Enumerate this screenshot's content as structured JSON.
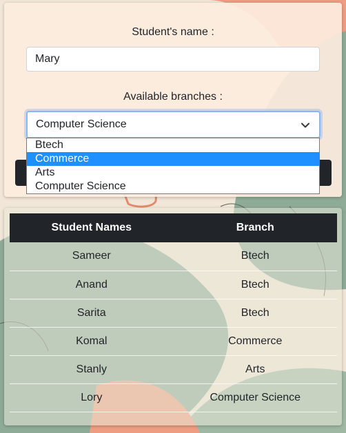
{
  "form": {
    "name_label": "Student's name :",
    "name_value": "Mary",
    "branch_label": "Available branches :",
    "selected_branch": "Computer Science",
    "options": [
      "Btech",
      "Commerce",
      "Arts",
      "Computer Science"
    ],
    "highlighted_option": "Commerce"
  },
  "table": {
    "headers": [
      "Student Names",
      "Branch"
    ],
    "rows": [
      [
        "Sameer",
        "Btech"
      ],
      [
        "Anand",
        "Btech"
      ],
      [
        "Sarita",
        "Btech"
      ],
      [
        "Komal",
        "Commerce"
      ],
      [
        "Stanly",
        "Arts"
      ],
      [
        "Lory",
        "Computer Science"
      ]
    ]
  },
  "colors": {
    "accent": "#1e90ff",
    "dark": "#212529",
    "focus_border": "#86b7fe",
    "bg_salmon": "#e8a58c",
    "bg_sage": "#9fb8a4"
  },
  "icons": {
    "select_chevron": "chevron-down-icon"
  }
}
